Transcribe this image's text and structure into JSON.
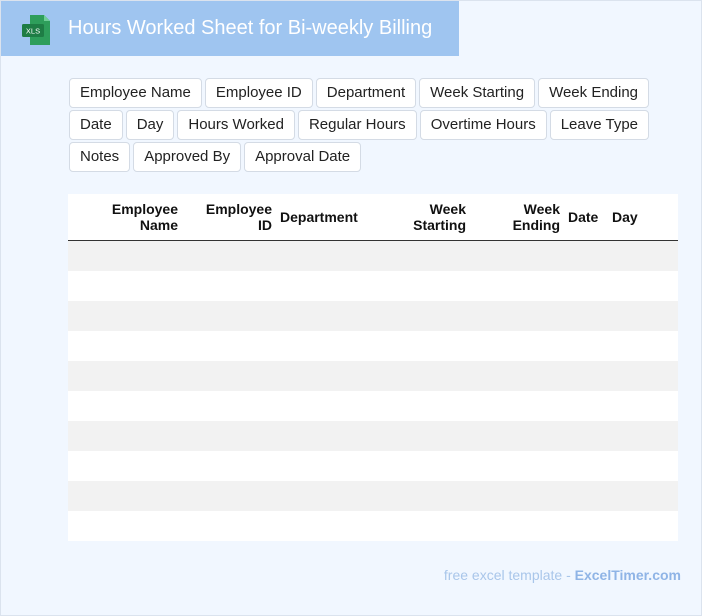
{
  "header": {
    "title": "Hours Worked Sheet for Bi-weekly Billing",
    "icon": "xls-file-icon",
    "icon_label": "XLS"
  },
  "fields": [
    "Employee Name",
    "Employee ID",
    "Department",
    "Week Starting",
    "Week Ending",
    "Date",
    "Day",
    "Hours Worked",
    "Regular Hours",
    "Overtime Hours",
    "Leave Type",
    "Notes",
    "Approved By",
    "Approval Date"
  ],
  "table": {
    "columns": [
      {
        "line1": "Employee",
        "line2": "Name"
      },
      {
        "line1": "Employee",
        "line2": "ID"
      },
      {
        "line1": "Department",
        "line2": ""
      },
      {
        "line1": "Week",
        "line2": "Starting"
      },
      {
        "line1": "Week",
        "line2": "Ending"
      },
      {
        "line1": "Date",
        "line2": ""
      },
      {
        "line1": "Day",
        "line2": ""
      }
    ],
    "rows": [
      [
        "",
        "",
        "",
        "",
        "",
        "",
        ""
      ],
      [
        "",
        "",
        "",
        "",
        "",
        "",
        ""
      ],
      [
        "",
        "",
        "",
        "",
        "",
        "",
        ""
      ],
      [
        "",
        "",
        "",
        "",
        "",
        "",
        ""
      ],
      [
        "",
        "",
        "",
        "",
        "",
        "",
        ""
      ],
      [
        "",
        "",
        "",
        "",
        "",
        "",
        ""
      ],
      [
        "",
        "",
        "",
        "",
        "",
        "",
        ""
      ],
      [
        "",
        "",
        "",
        "",
        "",
        "",
        ""
      ],
      [
        "",
        "",
        "",
        "",
        "",
        "",
        ""
      ],
      [
        "",
        "",
        "",
        "",
        "",
        "",
        ""
      ]
    ]
  },
  "footer": {
    "prefix": "free excel template -",
    "brand": "ExcelTimer.com"
  },
  "colors": {
    "header_bg": "#9fc5f0",
    "page_bg": "#f1f7ff",
    "icon_green": "#1e7d45",
    "row_stripe": "#f2f2f2"
  }
}
